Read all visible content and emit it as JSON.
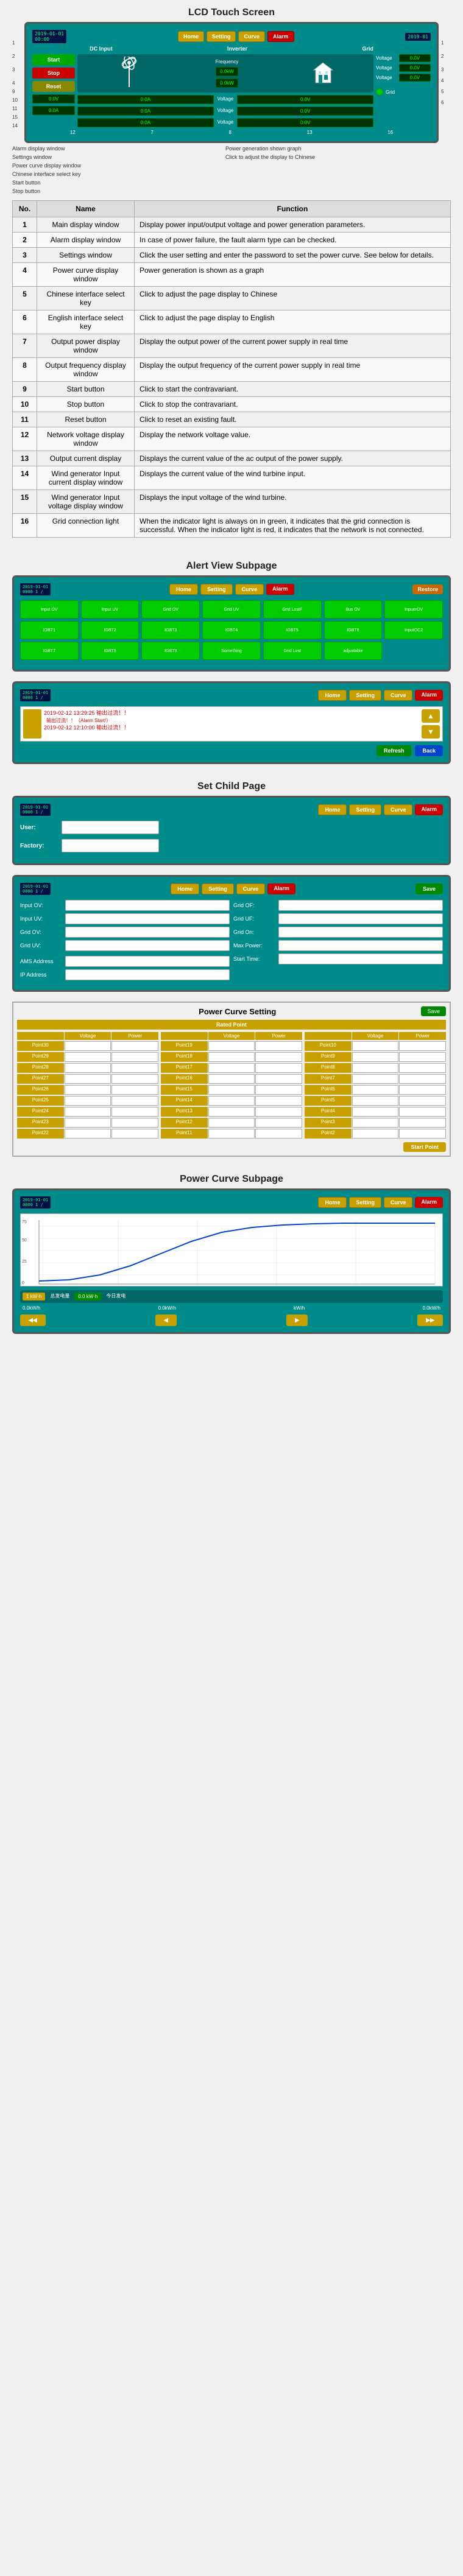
{
  "page": {
    "title": "LCD Touch Screen"
  },
  "lcd": {
    "date1": "2019-01-01",
    "time1": "00:00",
    "date2": "2019-01",
    "nav_buttons": [
      "Home",
      "Setting",
      "Curve",
      "Alarm"
    ],
    "alarm_btn": "Alarm",
    "dc_input": "DC Input",
    "inverter": "Inverter",
    "grid": "Grid",
    "frequency_label": "Frequency",
    "power_kw": "0.0kW",
    "power_kw2": "0.0kW",
    "start_label": "Start",
    "stop_label": "Stop",
    "reset_label": "Reset",
    "values": [
      "0.0V",
      "0.0A",
      "0.0V",
      "0.0A",
      "0.0V",
      "0.0V",
      "0.0V"
    ],
    "current_labels": [
      "0.0A",
      "0.0A",
      "0.0A"
    ],
    "voltage_labels": [
      "Voltage",
      "Voltage",
      "Voltage"
    ],
    "output_labels": [
      "Voltage",
      "Voltage",
      "Voltage"
    ]
  },
  "table": {
    "headers": [
      "No.",
      "Name",
      "Function"
    ],
    "rows": [
      {
        "no": 1,
        "name": "Main display window",
        "function": "Display power input/output voltage and power generation parameters."
      },
      {
        "no": 2,
        "name": "Alarm display window",
        "function": "In case of power failure, the fault alarm type can be checked."
      },
      {
        "no": 3,
        "name": "Settings window",
        "function": "Click the user setting and enter the password to set the power curve. See below for details."
      },
      {
        "no": 4,
        "name": "Power curve display window",
        "function": "Power generation is shown as a graph"
      },
      {
        "no": 5,
        "name": "Chinese interface select key",
        "function": "Click to adjust the page display to Chinese"
      },
      {
        "no": 6,
        "name": "English interface select key",
        "function": "Click to adjust the page display to English"
      },
      {
        "no": 7,
        "name": "Output power display window",
        "function": "Display the output power of the current power supply in real time"
      },
      {
        "no": 8,
        "name": "Output frequency display window",
        "function": "Display the output frequency of the current power supply in real time"
      },
      {
        "no": 9,
        "name": "Start button",
        "function": "Click to start the contravariant."
      },
      {
        "no": 10,
        "name": "Stop button",
        "function": "Click to stop the contravariant."
      },
      {
        "no": 11,
        "name": "Reset button",
        "function": "Click to reset an existing fault."
      },
      {
        "no": 12,
        "name": "Network voltage display window",
        "function": "Display the network voltage value."
      },
      {
        "no": 13,
        "name": "Output current display",
        "function": "Displays the current value of the ac output of the power supply."
      },
      {
        "no": 14,
        "name": "Wind generator Input current display window",
        "function": "Displays the current value of the wind turbine input."
      },
      {
        "no": 15,
        "name": "Wind generator Input voltage display window",
        "function": "Displays the input voltage of the wind turbine."
      },
      {
        "no": 16,
        "name": "Grid connection light",
        "function": "When the indicator light is always on in green, it indicates that the grid connection is successful. When the indicator light is red, it indicates that the network is not connected."
      }
    ]
  },
  "alert_view": {
    "title": "Alert View Subpage",
    "nav_buttons": [
      "Home",
      "Setting",
      "Curve",
      "Alarm"
    ],
    "restore_btn": "Restore",
    "alert_buttons": [
      {
        "label": "Input OV",
        "state": "green"
      },
      {
        "label": "Input UV",
        "state": "green"
      },
      {
        "label": "Grid OV",
        "state": "green"
      },
      {
        "label": "Grid UV",
        "state": "green"
      },
      {
        "label": "Grid LostF",
        "state": "green"
      },
      {
        "label": "Bus OV",
        "state": "green"
      },
      {
        "label": "InpuerOV",
        "state": "green"
      },
      {
        "label": "IGBT1",
        "state": "green"
      },
      {
        "label": "IGBT2",
        "state": "green"
      },
      {
        "label": "IGBT3",
        "state": "green"
      },
      {
        "label": "IGBT4",
        "state": "green"
      },
      {
        "label": "IGBT5",
        "state": "green"
      },
      {
        "label": "IGBT6",
        "state": "green"
      },
      {
        "label": "InputOC2",
        "state": "green"
      },
      {
        "label": "IGBT7",
        "state": "green"
      },
      {
        "label": "IGBT8",
        "state": "green"
      },
      {
        "label": "IGBT9",
        "state": "green"
      },
      {
        "label": "Something",
        "state": "green"
      },
      {
        "label": "Grid Lost",
        "state": "green"
      },
      {
        "label": "adjustable",
        "state": "green"
      }
    ]
  },
  "alert_log": {
    "entries": [
      {
        "time": "2019-02-12 13:29:25",
        "msg": "输出过流！！",
        "type": "error"
      },
      {
        "time": "2019-02-12 12:10:00",
        "msg": "输出过流！！",
        "type": "error"
      }
    ],
    "refresh_btn": "Refresh",
    "back_btn": "Back"
  },
  "set_child": {
    "title": "Set Child Page",
    "user_label": "User:",
    "factory_label": "Factory:"
  },
  "settings_page": {
    "fields": [
      {
        "label": "Input OV:",
        "value": ""
      },
      {
        "label": "Input UV:",
        "value": ""
      },
      {
        "label": "Grid OV:",
        "value": ""
      },
      {
        "label": "Grid UV:",
        "value": ""
      },
      {
        "label": "AMS Address",
        "value": ""
      },
      {
        "label": "IP Address",
        "value": ""
      }
    ],
    "right_fields": [
      {
        "label": "Grid OF:",
        "value": ""
      },
      {
        "label": "Grid UF:",
        "value": ""
      },
      {
        "label": "Grid On:",
        "value": ""
      },
      {
        "label": "Max Power:",
        "value": ""
      },
      {
        "label": "Start Time:",
        "value": ""
      }
    ],
    "save_btn": "Save"
  },
  "power_curve_setting": {
    "title": "Power Curve Setting",
    "save_btn": "Save",
    "rated_point": "Rated Point",
    "col_headers": [
      "Voltage",
      "Power"
    ],
    "points_col1": [
      "Point30",
      "Point29",
      "Point28",
      "Point27",
      "Point26",
      "Point25",
      "Point24",
      "Point23",
      "Point22"
    ],
    "points_col2": [
      "Point19",
      "Point18",
      "Point17",
      "Point16",
      "Point15",
      "Point14",
      "Point13",
      "Point12",
      "Point11"
    ],
    "points_col3": [
      "Point10",
      "Point9",
      "Point8",
      "Point7",
      "Point6",
      "Point5",
      "Point4",
      "Point3",
      "Point2"
    ],
    "start_point_btn": "Start Point"
  },
  "power_curve_subpage": {
    "title": "Power Curve Subpage",
    "nav_buttons": [
      "Home",
      "Setting",
      "Curve",
      "Alarm"
    ],
    "bottom_labels": [
      "0.0kW/h",
      "0.0kW/h",
      "kW/h",
      "0.0kW/h"
    ],
    "bottom_nav": [
      "◀◀",
      "◀",
      "▶",
      "▶▶"
    ]
  }
}
